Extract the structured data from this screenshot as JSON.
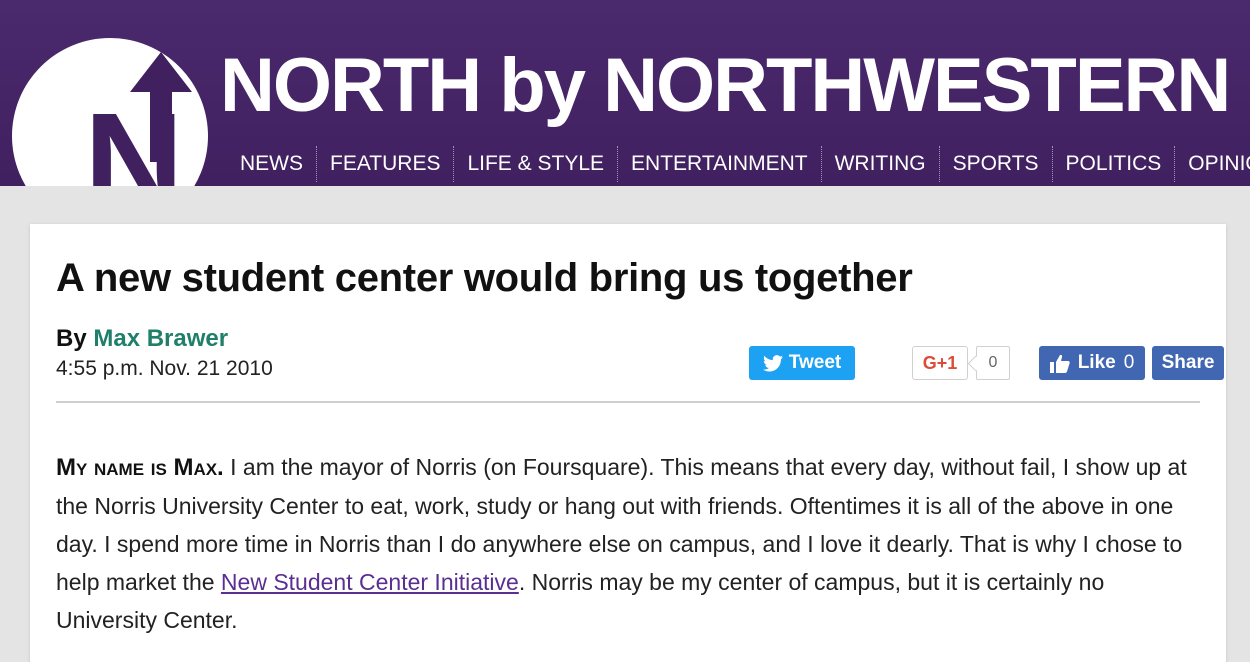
{
  "site": {
    "logo_letter": "N",
    "title": "NORTH by NORTHWESTERN",
    "colors": {
      "header_bg": "#40205f",
      "accent_link": "#5b2e91",
      "author_link": "#1f7f6a"
    }
  },
  "nav": {
    "items": [
      "NEWS",
      "FEATURES",
      "LIFE & STYLE",
      "ENTERTAINMENT",
      "WRITING",
      "SPORTS",
      "POLITICS",
      "OPINION"
    ]
  },
  "article": {
    "headline": "A new student center would bring us together",
    "byline_prefix": "By",
    "author": "Max Brawer",
    "date": "4:55 p.m. Nov. 21 2010",
    "body": {
      "lead_in": "My name is Max.",
      "text_1": " I am the mayor of Norris (on Foursquare). This means that every day, without fail, I show up at the Norris University Center to eat, work, study or hang out with friends. Oftentimes it is all of the above in one day. I spend more time in Norris than I do anywhere else on campus, and I love it dearly. That is why I chose to help market the ",
      "link_text": "New Student Center Initiative",
      "text_2": ". Norris may be my center of campus, but it is certainly no University Center."
    }
  },
  "social": {
    "tweet_label": "Tweet",
    "tweet_icon": "twitter-bird-icon",
    "gplus_label": "G+1",
    "gplus_count": "0",
    "fb_like_label": "Like",
    "fb_like_count": "0",
    "fb_like_icon": "thumbs-up-icon",
    "fb_share_label": "Share"
  }
}
